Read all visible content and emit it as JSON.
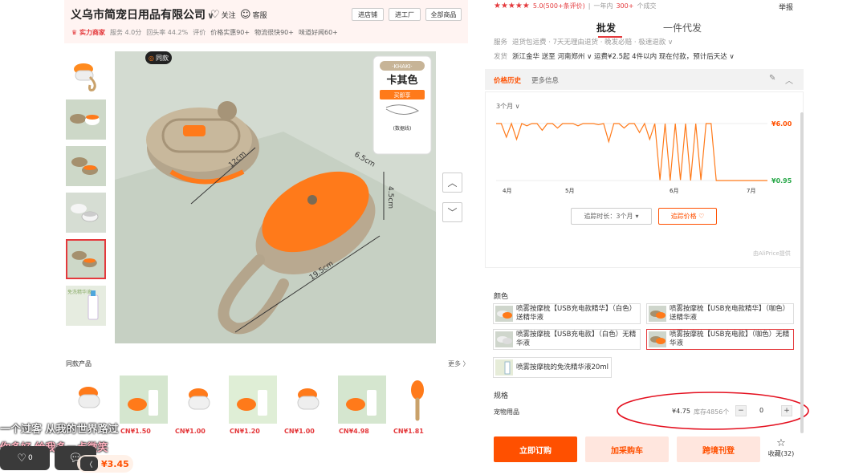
{
  "header": {
    "company": "义乌市简宠日用品有限公司",
    "follow": "关注",
    "service": "客服",
    "buttons": [
      "进店铺",
      "进工厂",
      "全部商品"
    ],
    "badge": "实力商家",
    "metrics": [
      "服务 4.0分",
      "回头率 44.2%",
      "评价"
    ],
    "metric_tags": [
      "价格实惠90+",
      "物流很快90+",
      "味道好闻60+"
    ]
  },
  "gallery": {
    "same_tag": "同款",
    "thumb_label": "免洗精华液",
    "product_labels": {
      "color_en": "·KHAKI·",
      "color_cn": "卡其色",
      "buy": "买即享",
      "cable": "(数据线)"
    },
    "dims": [
      "6.5cm",
      "12cm",
      "4.5cm",
      "19.5cm"
    ]
  },
  "similar": {
    "title": "同款产品",
    "more": "更多 〉",
    "prices": [
      "CN¥1.50",
      "CN¥1.00",
      "CN¥1.20",
      "CN¥1.00",
      "CN¥4.98",
      "CN¥1.81"
    ]
  },
  "live": {
    "line1": "一个过客 从我的世界路过",
    "line2": "你多好 给我多一点微笑",
    "price": "¥3.45",
    "count": "0",
    "chev": "〈"
  },
  "rating": {
    "stars": "★★★★★",
    "score": "5.0(500+条评价)",
    "sales_pre": "一年内",
    "sales_num": "300+",
    "sales_post": "个成交",
    "report": "举报"
  },
  "tabs": [
    "批发",
    "一件代发"
  ],
  "shipping": {
    "row1_label": "服务",
    "row1": "退货包运费 · 7天无理由退货 · 晚发必赔 · 极速退款 ∨",
    "row2_label": "发货",
    "row2": "浙江金华 送至 河南郑州 ∨   运费¥2.5起   4件以内 现在付款，预计后天达 ∨"
  },
  "price_history": {
    "tab_active": "价格历史",
    "tab_other": "更多信息",
    "range": "3个月 ∨",
    "high": "¥6.00",
    "low": "¥0.95",
    "duration_btn": "追踪时长：3个月",
    "track_btn": "追踪价格 ♡",
    "credit": "由AliPrice提供"
  },
  "chart_data": {
    "type": "line",
    "x_ticks": [
      "4月",
      "5月",
      "6月",
      "7月"
    ],
    "ylim": [
      0.95,
      6.0
    ],
    "series": [
      {
        "values": [
          6.0,
          6.0,
          4.8,
          6.0,
          4.6,
          6.0,
          5.8,
          6.0,
          6.0,
          5.4,
          6.0,
          6.0,
          5.6,
          6.0,
          6.0,
          6.0,
          5.8,
          6.0,
          6.0,
          6.0,
          5.9,
          6.0,
          4.4,
          6.0,
          6.0,
          5.6,
          6.0,
          6.0,
          5.2,
          6.0,
          4.6,
          6.0,
          1.0,
          6.0,
          0.95,
          6.0,
          1.0,
          6.0,
          0.95,
          6.0,
          1.0,
          6.0,
          6.0,
          0.95,
          0.95,
          0.95,
          0.95,
          0.95,
          0.95,
          0.95,
          0.95,
          0.95,
          0.95,
          0.95
        ]
      }
    ]
  },
  "colors": {
    "label": "颜色",
    "options": [
      "喷雾按摩梳【USB充电款精华】（白色）送精华液",
      "喷雾按摩梳【USB充电款精华】（咖色）送精华液",
      "喷雾按摩梳【USB充电款】（白色）无精华液",
      "喷雾按摩梳【USB充电款】（咖色）无精华液",
      "喷雾按摩梳的免洗精华液20ml"
    ]
  },
  "spec": {
    "label": "规格",
    "name": "宠物用品",
    "price": "¥4.75",
    "stock": "库存4856个",
    "minus": "−",
    "qty": "0",
    "plus": "+"
  },
  "actions": {
    "order": "立即订购",
    "cart": "加采购车",
    "cross": "跨境刊登",
    "fav": "收藏(32)",
    "fav_icon": "☆"
  },
  "accent": "#e4393c",
  "orange": "#ff5000"
}
